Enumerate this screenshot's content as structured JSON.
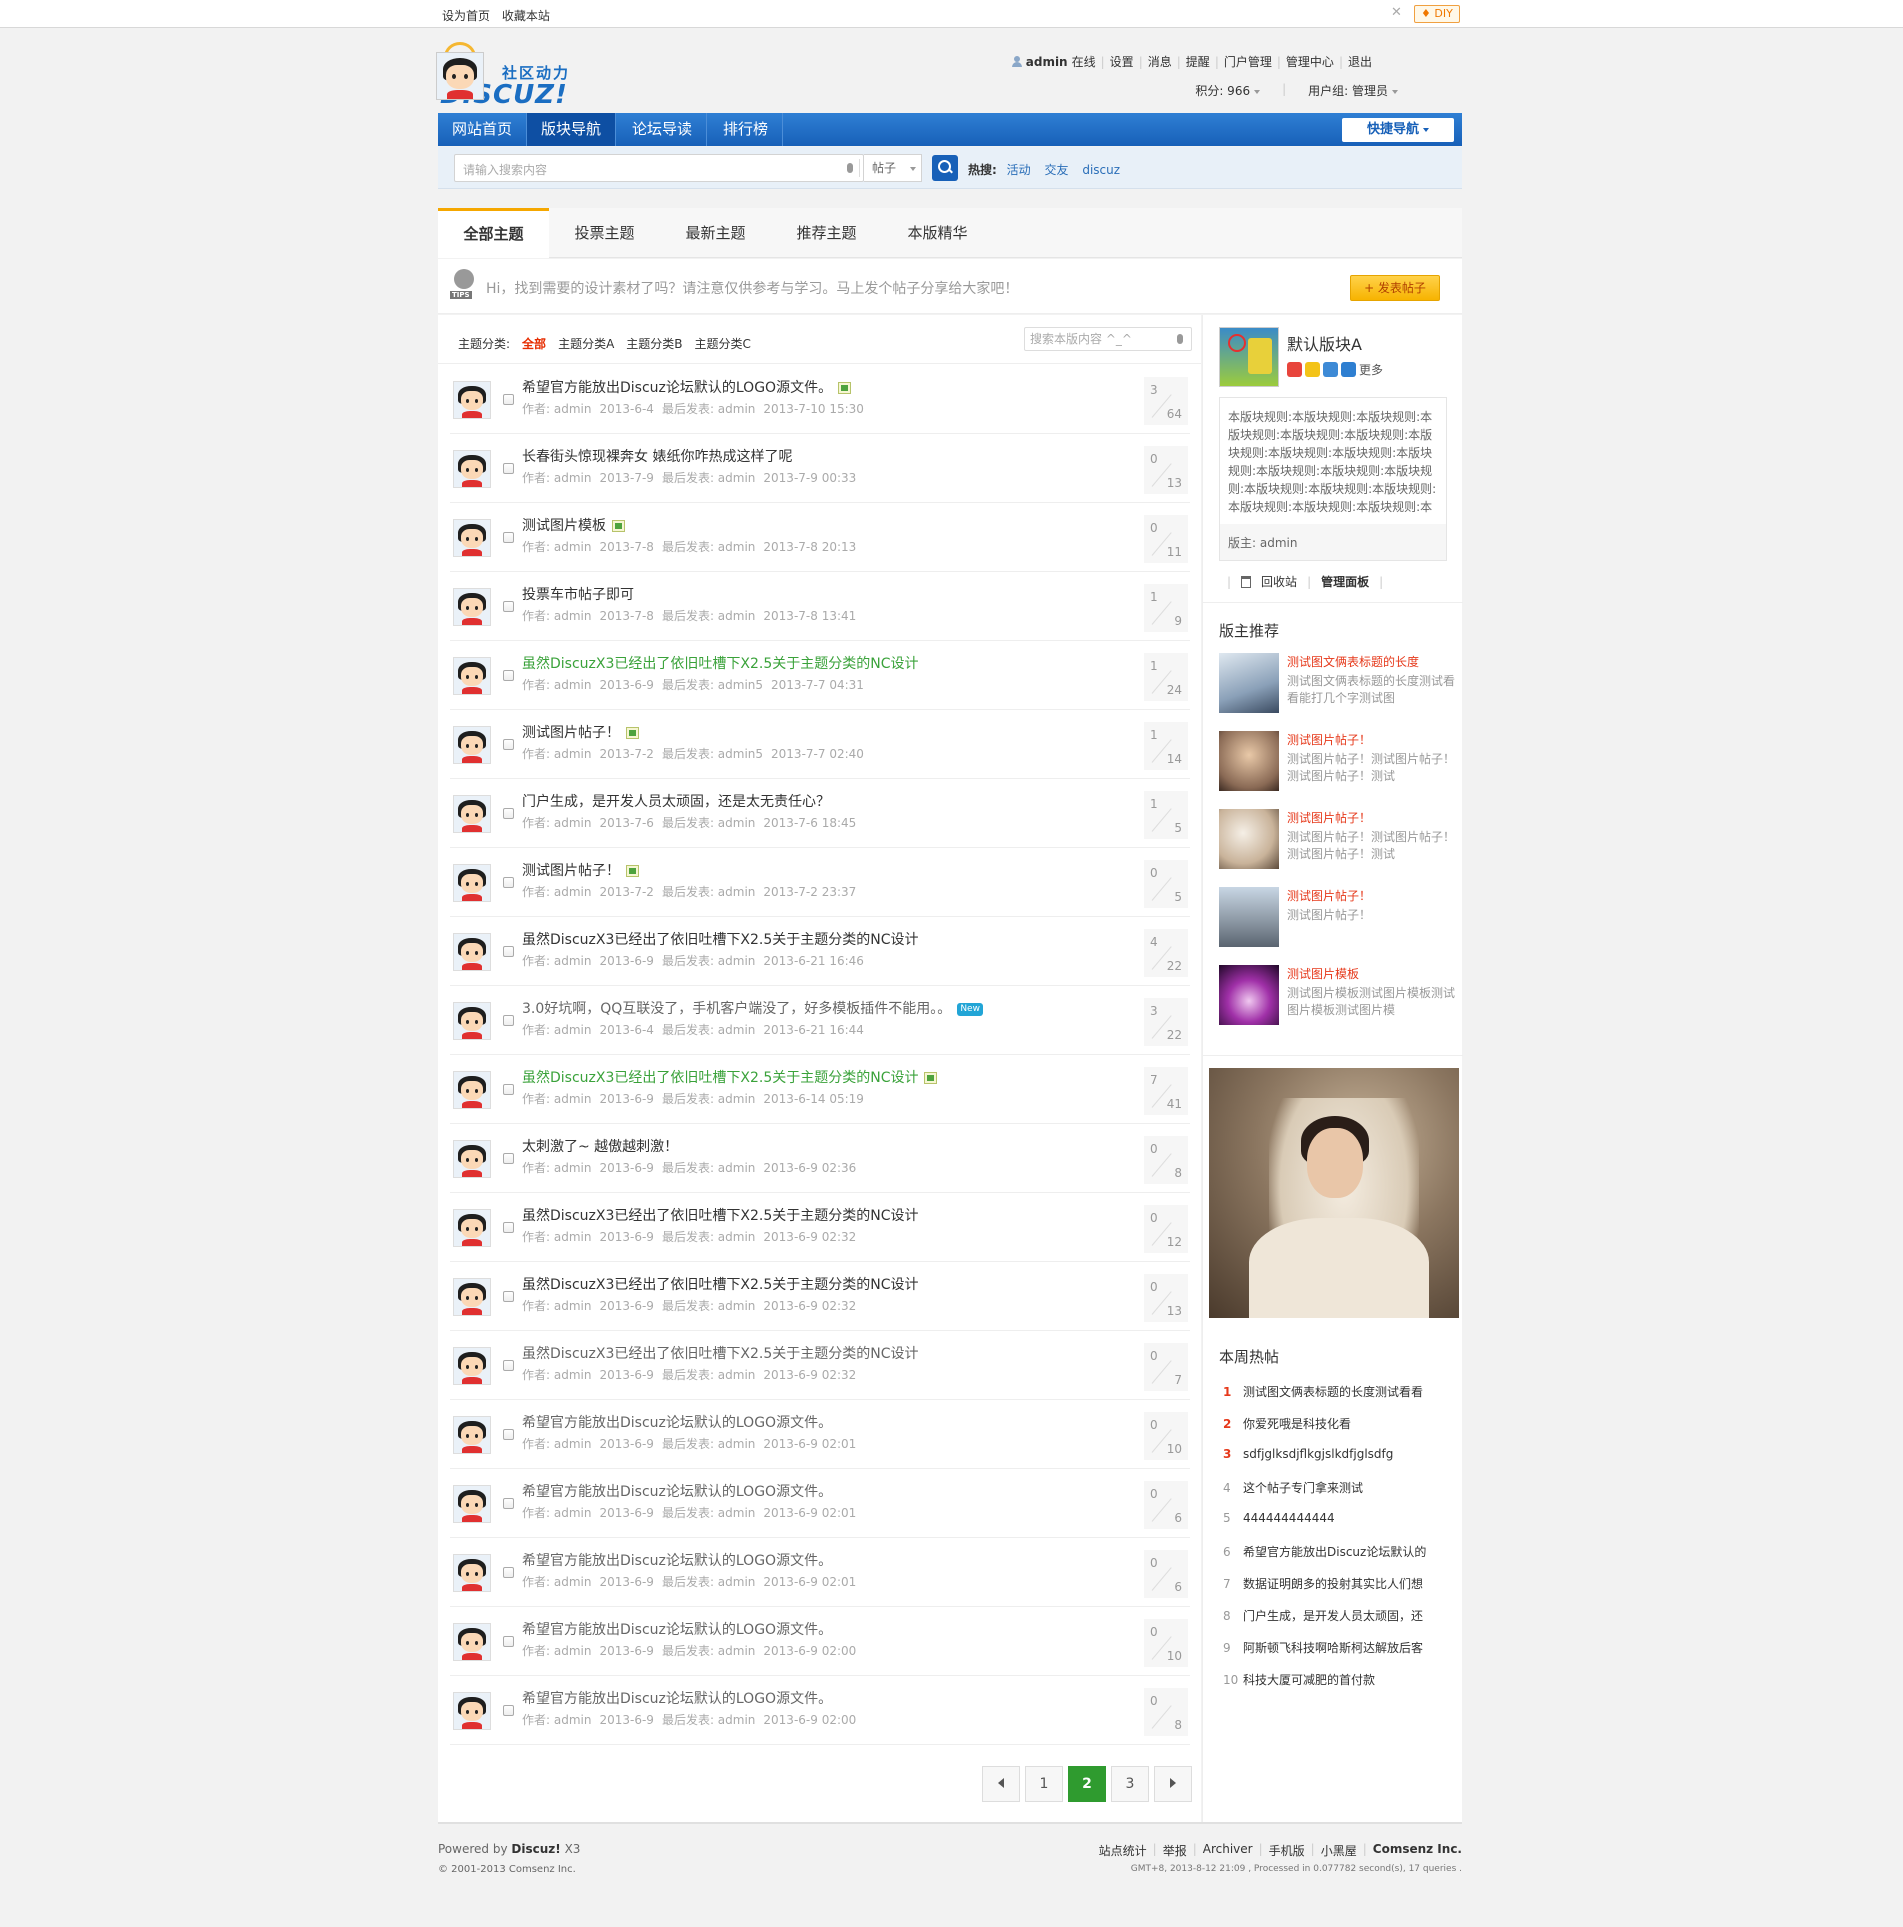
{
  "topbar": {
    "set_home": "设为首页",
    "bookmark": "收藏本站",
    "diy": "♦ DIY"
  },
  "logo": {
    "slogan": "社区动力",
    "word": "DISCUZ!"
  },
  "user": {
    "name": "admin",
    "status": "在线",
    "links": [
      "设置",
      "消息",
      "提醒",
      "门户管理",
      "管理中心",
      "退出"
    ],
    "credits": "积分: 966",
    "group": "用户组: 管理员"
  },
  "nav": {
    "items": [
      "网站首页",
      "版块导航",
      "论坛导读",
      "排行榜"
    ],
    "active_index": 1,
    "quick": "快捷导航"
  },
  "search": {
    "placeholder": "请输入搜索内容",
    "type": "帖子",
    "hot_label": "热搜:",
    "hot_keywords": [
      "活动",
      "交友",
      "discuz"
    ]
  },
  "tabs": [
    "全部主题",
    "投票主题",
    "最新主题",
    "推荐主题",
    "本版精华"
  ],
  "tips": {
    "text": "Hi，找到需要的设计素材了吗？请注意仅供参考与学习。马上发个帖子分享给大家吧！",
    "post_button": "+ 发表帖子"
  },
  "filter": {
    "label": "主题分类:",
    "categories": [
      "全部",
      "主题分类A",
      "主题分类B",
      "主题分类C"
    ],
    "search_placeholder": "搜索本版内容 ^_^"
  },
  "threads": [
    {
      "title": "希望官方能放出Discuz论坛默认的LOGO源文件。",
      "style": "normal",
      "icon": "attach",
      "author": "作者: admin",
      "date": "2013-6-4",
      "last": "最后发表: admin",
      "lastdate": "2013-7-10 15:30",
      "replies": "3",
      "views": "64"
    },
    {
      "title": "长春街头惊现裸奔女 婊纸你咋热成这样了呢",
      "style": "normal",
      "icon": "",
      "author": "作者: admin",
      "date": "2013-7-9",
      "last": "最后发表: admin",
      "lastdate": "2013-7-9 00:33",
      "replies": "0",
      "views": "13"
    },
    {
      "title": "测试图片模板",
      "style": "normal",
      "icon": "attach",
      "author": "作者: admin",
      "date": "2013-7-8",
      "last": "最后发表: admin",
      "lastdate": "2013-7-8 20:13",
      "replies": "0",
      "views": "11"
    },
    {
      "title": "投票车市帖子即可",
      "style": "normal",
      "icon": "",
      "author": "作者: admin",
      "date": "2013-7-8",
      "last": "最后发表: admin",
      "lastdate": "2013-7-8 13:41",
      "replies": "1",
      "views": "9"
    },
    {
      "title": "虽然DiscuzX3已经出了依旧吐槽下X2.5关于主题分类的NC设计",
      "style": "green",
      "icon": "",
      "author": "作者: admin",
      "date": "2013-6-9",
      "last": "最后发表: admin5",
      "lastdate": "2013-7-7 04:31",
      "replies": "1",
      "views": "24"
    },
    {
      "title": "测试图片帖子！",
      "style": "normal",
      "icon": "attach",
      "author": "作者: admin",
      "date": "2013-7-2",
      "last": "最后发表: admin5",
      "lastdate": "2013-7-7 02:40",
      "replies": "1",
      "views": "14"
    },
    {
      "title": "门户生成，是开发人员太顽固，还是太无责任心？",
      "style": "normal",
      "icon": "",
      "author": "作者: admin",
      "date": "2013-7-6",
      "last": "最后发表: admin",
      "lastdate": "2013-7-6 18:45",
      "replies": "1",
      "views": "5"
    },
    {
      "title": "测试图片帖子！",
      "style": "normal",
      "icon": "attach",
      "author": "作者: admin",
      "date": "2013-7-2",
      "last": "最后发表: admin",
      "lastdate": "2013-7-2 23:37",
      "replies": "0",
      "views": "5"
    },
    {
      "title": "虽然DiscuzX3已经出了依旧吐槽下X2.5关于主题分类的NC设计",
      "style": "normal",
      "icon": "",
      "author": "作者: admin",
      "date": "2013-6-9",
      "last": "最后发表: admin",
      "lastdate": "2013-6-21 16:46",
      "replies": "4",
      "views": "22"
    },
    {
      "title": "3.0好坑啊，QQ互联没了，手机客户端没了，好多模板插件不能用。。",
      "style": "grey",
      "icon": "badge",
      "author": "作者: admin",
      "date": "2013-6-4",
      "last": "最后发表: admin",
      "lastdate": "2013-6-21 16:44",
      "replies": "3",
      "views": "22"
    },
    {
      "title": "虽然DiscuzX3已经出了依旧吐槽下X2.5关于主题分类的NC设计",
      "style": "green",
      "icon": "attach",
      "author": "作者: admin",
      "date": "2013-6-9",
      "last": "最后发表: admin",
      "lastdate": "2013-6-14 05:19",
      "replies": "7",
      "views": "41"
    },
    {
      "title": "太刺激了~ 越傲越刺激！",
      "style": "normal",
      "icon": "",
      "author": "作者: admin",
      "date": "2013-6-9",
      "last": "最后发表: admin",
      "lastdate": "2013-6-9 02:36",
      "replies": "0",
      "views": "8"
    },
    {
      "title": "虽然DiscuzX3已经出了依旧吐槽下X2.5关于主题分类的NC设计",
      "style": "normal",
      "icon": "",
      "author": "作者: admin",
      "date": "2013-6-9",
      "last": "最后发表: admin",
      "lastdate": "2013-6-9 02:32",
      "replies": "0",
      "views": "12"
    },
    {
      "title": "虽然DiscuzX3已经出了依旧吐槽下X2.5关于主题分类的NC设计",
      "style": "normal",
      "icon": "",
      "author": "作者: admin",
      "date": "2013-6-9",
      "last": "最后发表: admin",
      "lastdate": "2013-6-9 02:32",
      "replies": "0",
      "views": "13"
    },
    {
      "title": "虽然DiscuzX3已经出了依旧吐槽下X2.5关于主题分类的NC设计",
      "style": "grey",
      "icon": "",
      "author": "作者: admin",
      "date": "2013-6-9",
      "last": "最后发表: admin",
      "lastdate": "2013-6-9 02:32",
      "replies": "0",
      "views": "7"
    },
    {
      "title": "希望官方能放出Discuz论坛默认的LOGO源文件。",
      "style": "grey",
      "icon": "",
      "author": "作者: admin",
      "date": "2013-6-9",
      "last": "最后发表: admin",
      "lastdate": "2013-6-9 02:01",
      "replies": "0",
      "views": "10"
    },
    {
      "title": "希望官方能放出Discuz论坛默认的LOGO源文件。",
      "style": "grey",
      "icon": "",
      "author": "作者: admin",
      "date": "2013-6-9",
      "last": "最后发表: admin",
      "lastdate": "2013-6-9 02:01",
      "replies": "0",
      "views": "6"
    },
    {
      "title": "希望官方能放出Discuz论坛默认的LOGO源文件。",
      "style": "grey",
      "icon": "",
      "author": "作者: admin",
      "date": "2013-6-9",
      "last": "最后发表: admin",
      "lastdate": "2013-6-9 02:01",
      "replies": "0",
      "views": "6"
    },
    {
      "title": "希望官方能放出Discuz论坛默认的LOGO源文件。",
      "style": "grey",
      "icon": "",
      "author": "作者: admin",
      "date": "2013-6-9",
      "last": "最后发表: admin",
      "lastdate": "2013-6-9 02:00",
      "replies": "0",
      "views": "10"
    },
    {
      "title": "希望官方能放出Discuz论坛默认的LOGO源文件。",
      "style": "grey",
      "icon": "",
      "author": "作者: admin",
      "date": "2013-6-9",
      "last": "最后发表: admin",
      "lastdate": "2013-6-9 02:00",
      "replies": "0",
      "views": "8"
    }
  ],
  "pager": {
    "pages": [
      "1",
      "2",
      "3"
    ],
    "current": "2"
  },
  "sidebar": {
    "forum_name": "默认版块A",
    "more": "更多",
    "rules": "本版块规则:本版块规则:本版块规则:本版块规则:本版块规则:本版块规则:本版块规则:本版块规则:本版块规则:本版块规则:本版块规则:本版块规则:本版块规则:本版块规则:本版块规则:本版块规则:本版块规则:本版块规则:本版块规则:本版块规则:",
    "moderator": "版主: admin",
    "recycle": "回收站",
    "manage": "管理面板",
    "recommend_title": "版主推荐",
    "recommends": [
      {
        "title": "测试图文俩表标题的长度",
        "desc": "测试图文俩表标题的长度测试看看能打几个字测试图"
      },
      {
        "title": "测试图片帖子！",
        "desc": "测试图片帖子！测试图片帖子！测试图片帖子！测试"
      },
      {
        "title": "测试图片帖子！",
        "desc": "测试图片帖子！测试图片帖子！测试图片帖子！测试"
      },
      {
        "title": "测试图片帖子！",
        "desc": "测试图片帖子！"
      },
      {
        "title": "测试图片模板",
        "desc": "测试图片模板测试图片模板测试图片模板测试图片模"
      }
    ],
    "hot_title": "本周热帖",
    "hot": [
      {
        "n": "1",
        "t": "测试图文俩表标题的长度测试看看"
      },
      {
        "n": "2",
        "t": "你爱死哦是科技化看"
      },
      {
        "n": "3",
        "t": "sdfjglksdjflkgjslkdfjglsdfg"
      },
      {
        "n": "4",
        "t": "这个帖子专门拿来测试"
      },
      {
        "n": "5",
        "t": "444444444444"
      },
      {
        "n": "6",
        "t": "希望官方能放出Discuz论坛默认的"
      },
      {
        "n": "7",
        "t": "数据证明朗多的投射其实比人们想"
      },
      {
        "n": "8",
        "t": "门户生成，是开发人员太顽固，还"
      },
      {
        "n": "9",
        "t": "阿斯顿飞科技啊哈斯柯达解放后客"
      },
      {
        "n": "10",
        "t": "科技大厦可减肥的首付款"
      }
    ]
  },
  "footer": {
    "powered": "Powered by",
    "brand": "Discuz!",
    "version": "X3",
    "copyright": "© 2001-2013 Comsenz Inc.",
    "links": [
      "站点统计",
      "举报",
      "Archiver",
      "手机版",
      "小黑屋"
    ],
    "company": "Comsenz Inc.",
    "gmt": "GMT+8, 2013-8-12 21:09 , Processed in 0.077782 second(s), 17 queries ."
  }
}
